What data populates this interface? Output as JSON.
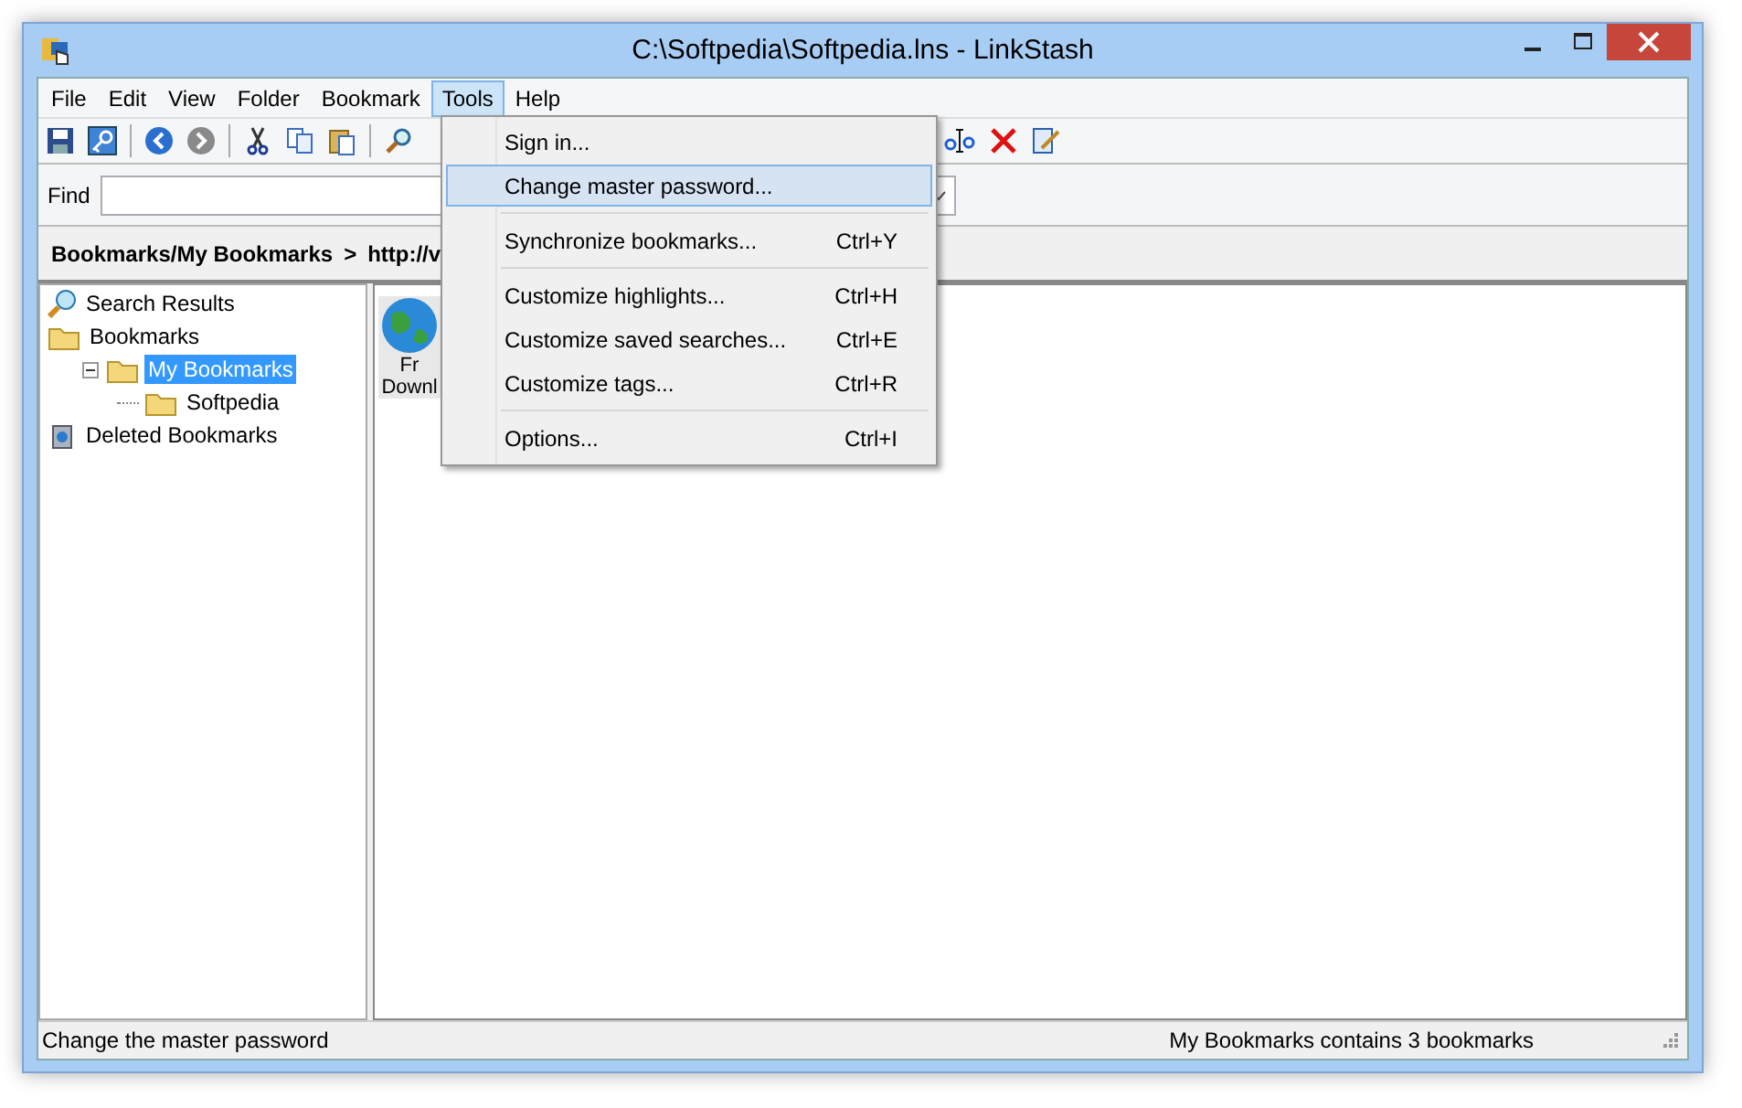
{
  "window": {
    "title": "C:\\Softpedia\\Softpedia.lns - LinkStash"
  },
  "menu_bar": [
    {
      "label": "File",
      "selected": false
    },
    {
      "label": "Edit",
      "selected": false
    },
    {
      "label": "View",
      "selected": false
    },
    {
      "label": "Folder",
      "selected": false
    },
    {
      "label": "Bookmark",
      "selected": false
    },
    {
      "label": "Tools",
      "selected": true
    },
    {
      "label": "Help",
      "selected": false
    }
  ],
  "tools_menu": [
    {
      "kind": "item",
      "label": "Sign in...",
      "selected": false
    },
    {
      "kind": "item",
      "label": "Change master password...",
      "selected": true
    },
    {
      "kind": "separator"
    },
    {
      "kind": "item",
      "label": "Synchronize bookmarks...",
      "shortcut": "Ctrl+Y",
      "selected": false
    },
    {
      "kind": "separator"
    },
    {
      "kind": "item",
      "label": "Customize highlights...",
      "shortcut": "Ctrl+H",
      "selected": false
    },
    {
      "kind": "item",
      "label": "Customize saved searches...",
      "shortcut": "Ctrl+E",
      "selected": false
    },
    {
      "kind": "item",
      "label": "Customize tags...",
      "shortcut": "Ctrl+R",
      "selected": false
    },
    {
      "kind": "separator"
    },
    {
      "kind": "item",
      "label": "Options...",
      "shortcut": "Ctrl+I",
      "selected": false
    }
  ],
  "find_bar": {
    "label": "Find"
  },
  "breadcrumb": {
    "path": "Bookmarks/My Bookmarks",
    "separator": ">",
    "url": "http://v"
  },
  "tree": [
    {
      "label": "Search Results",
      "kind": "search",
      "selected": false
    },
    {
      "label": "Bookmarks",
      "kind": "folder",
      "selected": false,
      "children": [
        {
          "label": "My Bookmarks",
          "kind": "folder",
          "selected": true,
          "expanded": true,
          "children": [
            {
              "label": "Softpedia",
              "kind": "folder",
              "selected": false
            }
          ]
        }
      ]
    },
    {
      "label": "Deleted Bookmarks",
      "kind": "trash",
      "selected": false
    }
  ],
  "bookmark_tile": {
    "lines": [
      "Fr",
      "Downl"
    ]
  },
  "status_bar": {
    "left": "Change the master password",
    "right": "My Bookmarks contains 3 bookmarks"
  }
}
